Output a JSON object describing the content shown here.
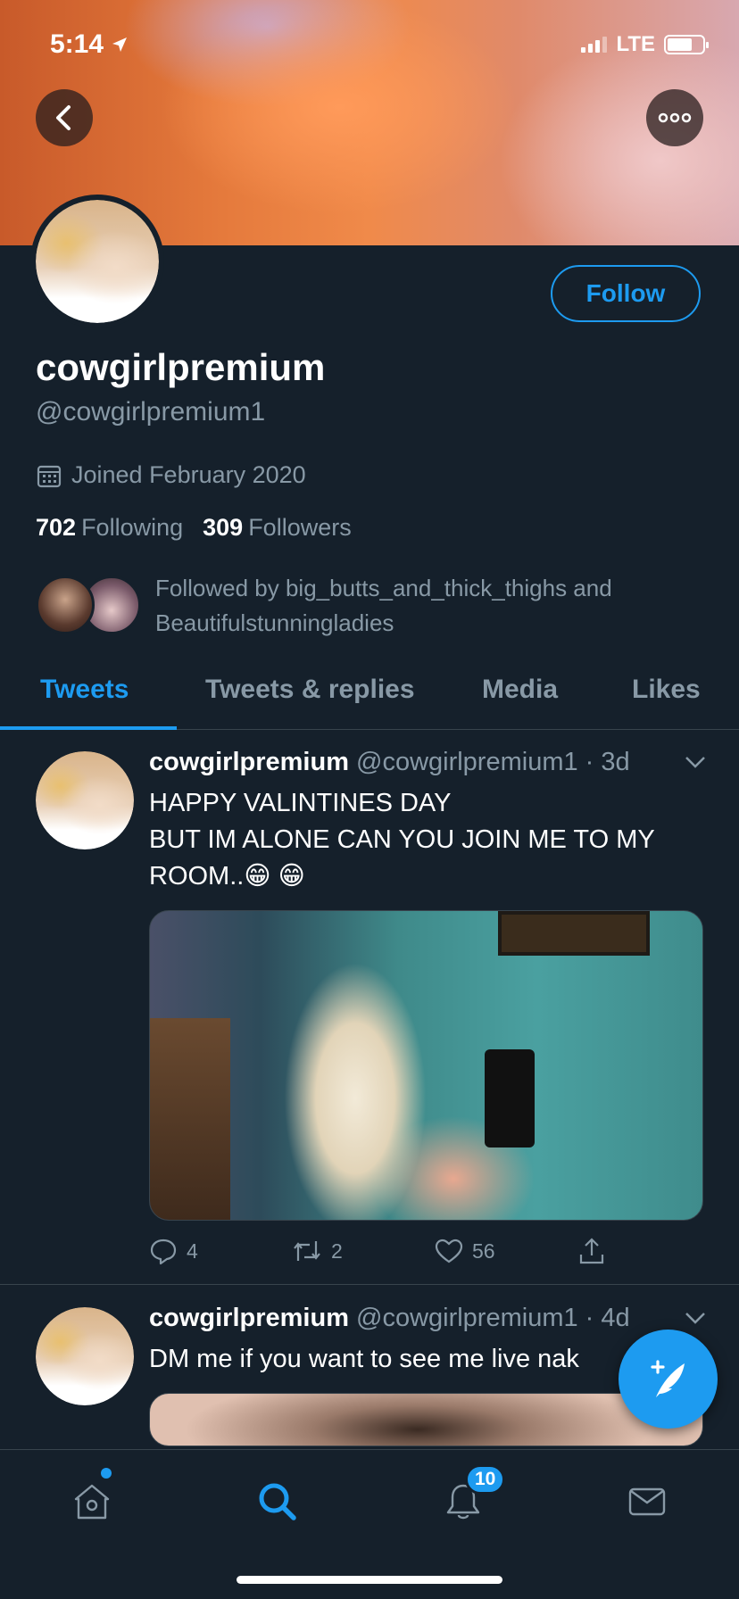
{
  "status": {
    "time": "5:14",
    "network": "LTE"
  },
  "profile": {
    "display_name": "cowgirlpremium",
    "handle": "@cowgirlpremium1",
    "joined": "Joined February 2020",
    "following_count": "702",
    "following_label": "Following",
    "followers_count": "309",
    "followers_label": "Followers",
    "followed_by_text": "Followed by big_butts_and_thick_thighs and Beautifulstunningladies",
    "follow_button": "Follow"
  },
  "tabs": [
    "Tweets",
    "Tweets & replies",
    "Media",
    "Likes"
  ],
  "tweets": [
    {
      "name": "cowgirlpremium",
      "handle": "@cowgirlpremium1",
      "time": "· 3d",
      "text_line1": "HAPPY VALINTINES DAY",
      "text_line2": "BUT IM ALONE CAN YOU JOIN ME TO MY ROOM..😁 😁",
      "replies": "4",
      "retweets": "2",
      "likes": "56"
    },
    {
      "name": "cowgirlpremium",
      "handle": "@cowgirlpremium1",
      "time": "· 4d",
      "text": "DM me if you want to see me live nak"
    }
  ],
  "nav": {
    "notifications_badge": "10"
  },
  "colors": {
    "accent": "#1d9bf0",
    "background": "#15202b",
    "muted": "#8899a6",
    "divider": "#38444d"
  },
  "icons": [
    "location-arrow-icon",
    "back-arrow-icon",
    "more-icon",
    "calendar-icon",
    "reply-icon",
    "retweet-icon",
    "like-icon",
    "share-icon",
    "chevron-down-icon",
    "compose-tweet-icon",
    "home-icon",
    "search-icon",
    "notifications-icon",
    "messages-icon"
  ]
}
